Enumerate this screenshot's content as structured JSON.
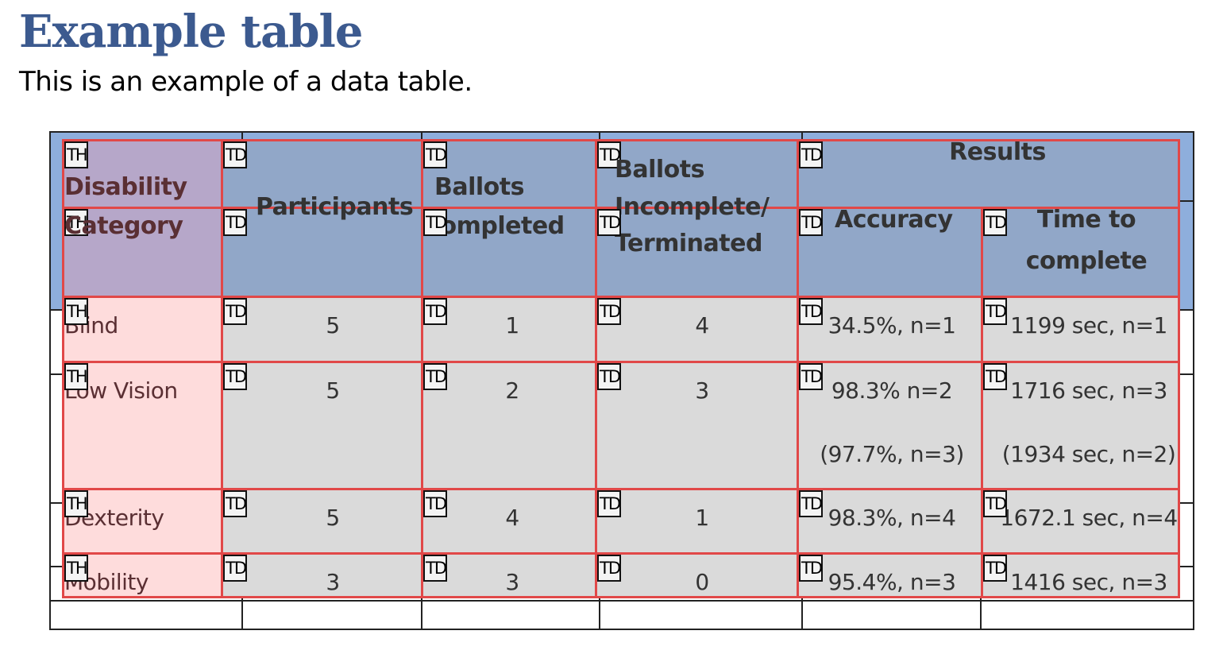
{
  "page": {
    "title": "Example table",
    "subtitle": "This is an example of a data table."
  },
  "table": {
    "headers": {
      "disability_category": "Disability\nCategory",
      "disability_line1": "Disability",
      "disability_line2": "Category",
      "participants": "Participants",
      "ballots_completed_line1": "Ballots",
      "ballots_completed_line2": "Completed",
      "ballots_incomplete_line1": "Ballots",
      "ballots_incomplete_line2": "Incomplete/",
      "ballots_incomplete_line3": "Terminated",
      "results": "Results",
      "accuracy": "Accuracy",
      "time_line1": "Time to",
      "time_line2": "complete"
    },
    "rows": [
      {
        "category": "Blind",
        "participants": "5",
        "completed": "1",
        "incomplete": "4",
        "accuracy": "34.5%, n=1",
        "accuracy_extra": "",
        "time": "1199 sec, n=1",
        "time_extra": ""
      },
      {
        "category": "Low Vision",
        "participants": "5",
        "completed": "2",
        "incomplete": "3",
        "accuracy": "98.3% n=2",
        "accuracy_extra": "(97.7%, n=3)",
        "time": "1716 sec, n=3",
        "time_extra": "(1934 sec, n=2)"
      },
      {
        "category": "Dexterity",
        "participants": "5",
        "completed": "4",
        "incomplete": "1",
        "accuracy": "98.3%, n=4",
        "accuracy_extra": "",
        "time": "1672.1 sec, n=4",
        "time_extra": ""
      },
      {
        "category": "Mobility",
        "participants": "3",
        "completed": "3",
        "incomplete": "0",
        "accuracy": "95.4%, n=3",
        "accuracy_extra": "",
        "time": "1416 sec, n=3",
        "time_extra": ""
      }
    ]
  },
  "tags": {
    "th": "TH",
    "td": "TD"
  },
  "colors": {
    "title": "#3c5a8f",
    "header_band": "#8eaedc",
    "th_header_cell": "#b6a7c9",
    "td_header_cell": "#91a7c8",
    "th_body_cell": "#fedcdc",
    "td_body_cell": "#dadada",
    "overlay_border": "#e14848"
  }
}
